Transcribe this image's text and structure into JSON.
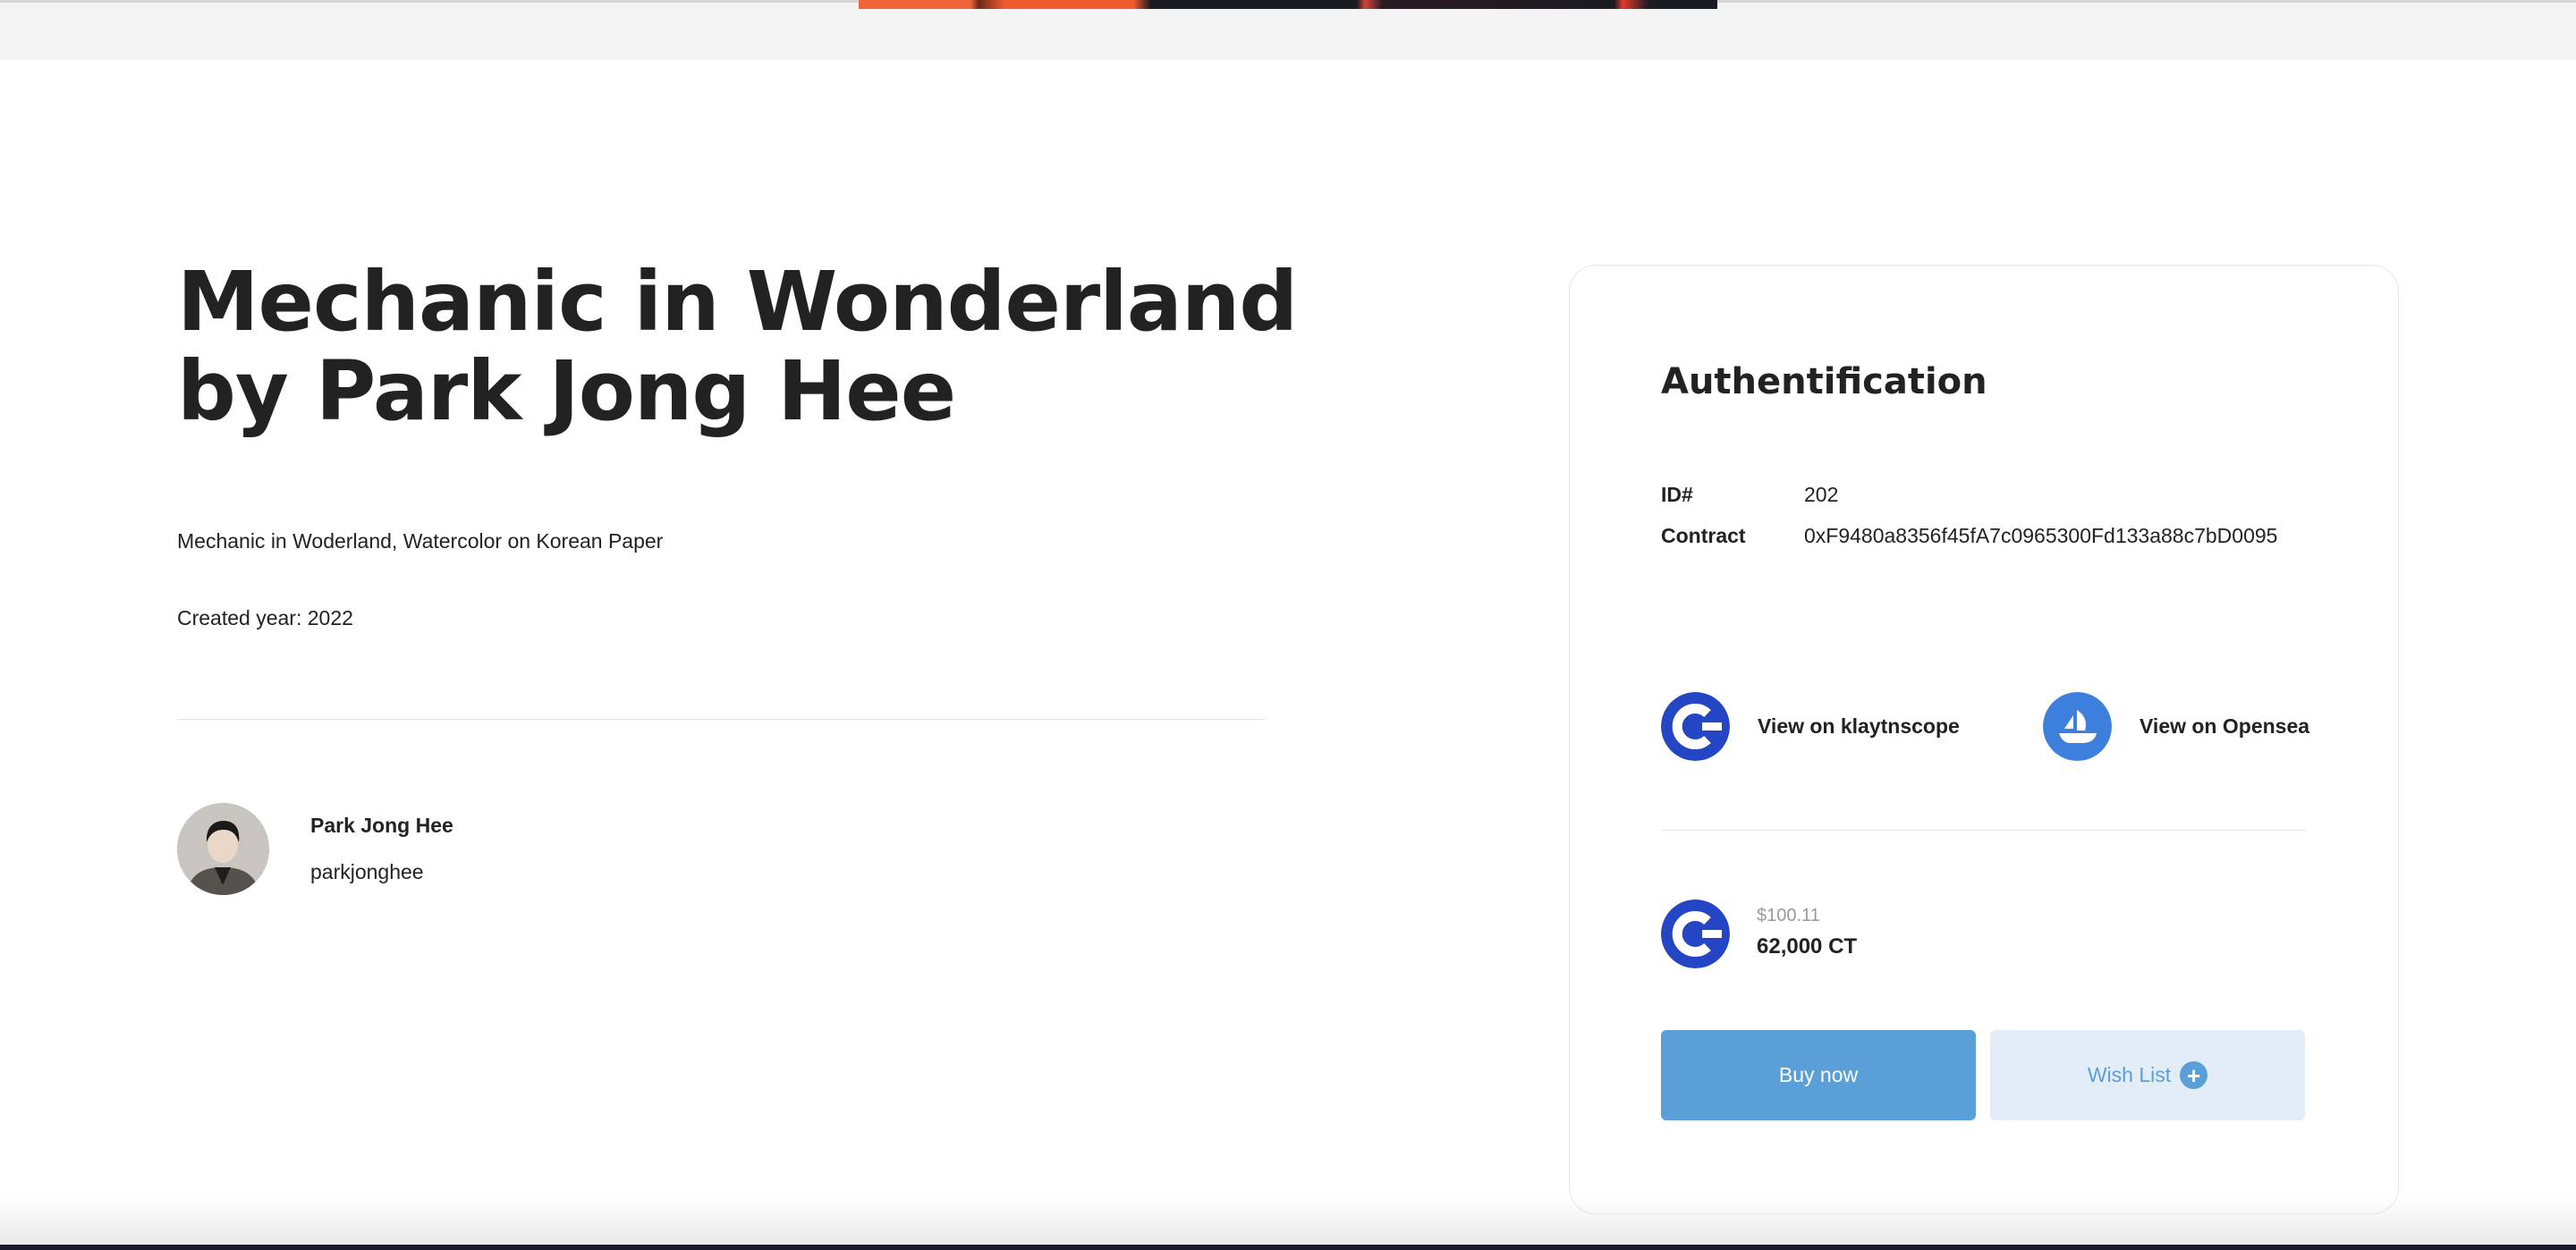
{
  "artwork": {
    "title_line1": "Mechanic in Wonderland",
    "title_line2": "by Park Jong Hee",
    "description": "Mechanic in Woderland, Watercolor on Korean Paper",
    "created_year": "Created year: 2022"
  },
  "artist": {
    "name": "Park Jong Hee",
    "handle": "parkjonghee"
  },
  "auth": {
    "title": "Authentification",
    "id_label": "ID#",
    "id_value": "202",
    "contract_label": "Contract",
    "contract_value": "0xF9480a8356f45fA7c0965300Fd133a88c7bD0095",
    "klaytnscope_label": "View on klaytnscope",
    "opensea_label": "View on Opensea"
  },
  "price": {
    "usd": "$100.11",
    "ct": "62,000 CT"
  },
  "actions": {
    "buy_label": "Buy now",
    "wish_label": "Wish List",
    "wish_icon": "+"
  },
  "colors": {
    "brand_blue": "#2445c4",
    "opensea_blue": "#3d7fdc",
    "button_blue": "#5b9fd8",
    "button_light": "#e2edf8",
    "text": "#222222"
  },
  "icons": {
    "klaytnscope": "klaytn-c-icon",
    "opensea": "opensea-boat-icon",
    "price_token": "klaytn-c-icon",
    "wish": "plus-icon"
  }
}
